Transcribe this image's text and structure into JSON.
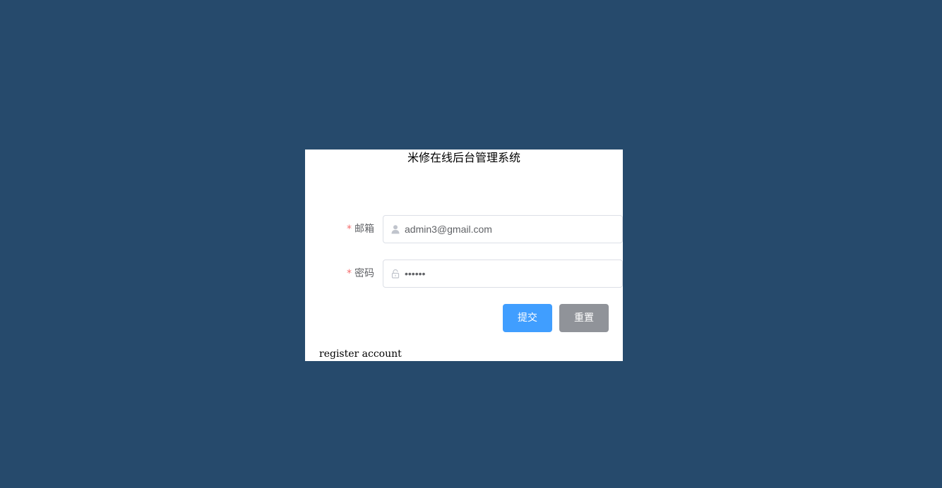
{
  "login": {
    "title": "米修在线后台管理系统",
    "email": {
      "required_mark": "*",
      "label": "邮箱",
      "value": "admin3@gmail.com",
      "icon": "user-icon"
    },
    "password": {
      "required_mark": "*",
      "label": "密码",
      "value": "••••••",
      "icon": "lock-icon"
    },
    "submit_label": "提交",
    "reset_label": "重置",
    "register_link": "register account"
  },
  "colors": {
    "background": "#264a6c",
    "card": "#ffffff",
    "primary": "#409eff",
    "info": "#909399",
    "required": "#f56c6c"
  }
}
